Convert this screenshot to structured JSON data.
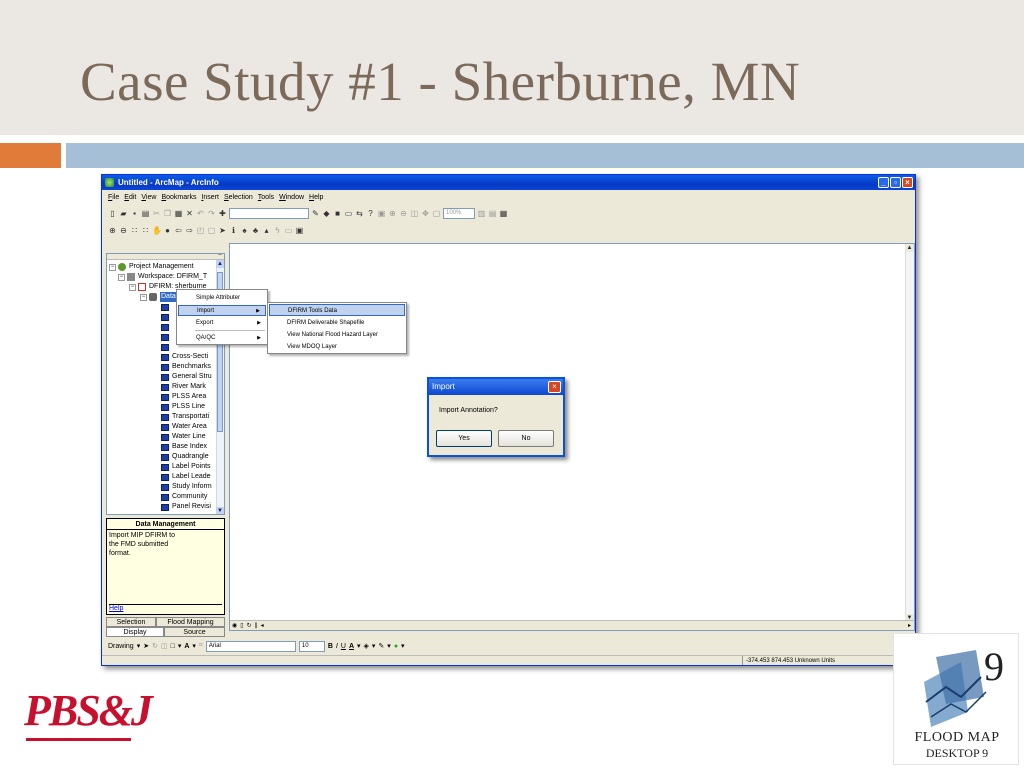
{
  "slide": {
    "title": "Case Study #1 - Sherburne, MN",
    "colors": {
      "title": "#7b6a5a",
      "header_bg": "#ebe8e4",
      "accent_orange": "#e07b39",
      "accent_blue": "#a4bfd6"
    }
  },
  "window": {
    "title": "Untitled - ArcMap - ArcInfo",
    "menu": [
      "File",
      "Edit",
      "View",
      "Bookmarks",
      "Insert",
      "Selection",
      "Tools",
      "Window",
      "Help"
    ],
    "zoom": "100%"
  },
  "toc": {
    "items": [
      {
        "label": "Project Management",
        "icon": "project-icon"
      },
      {
        "label": "Workspace: DFIRM_T",
        "icon": "workspace-icon"
      },
      {
        "label": "DFIRM: sherburne_",
        "icon": "dfirm-icon"
      },
      {
        "label": "Data",
        "icon": "database-icon"
      },
      {
        "label": "Cross-Secti",
        "icon": "layer-icon"
      },
      {
        "label": "Benchmarks",
        "icon": "layer-icon"
      },
      {
        "label": "General Stru",
        "icon": "layer-icon"
      },
      {
        "label": "River Mark",
        "icon": "layer-icon"
      },
      {
        "label": "PLSS Area",
        "icon": "layer-icon"
      },
      {
        "label": "PLSS Line",
        "icon": "layer-icon"
      },
      {
        "label": "Transportati",
        "icon": "layer-icon"
      },
      {
        "label": "Water Area",
        "icon": "layer-icon"
      },
      {
        "label": "Water Line",
        "icon": "layer-icon"
      },
      {
        "label": "Base Index",
        "icon": "layer-icon"
      },
      {
        "label": "Quadrangle",
        "icon": "layer-icon"
      },
      {
        "label": "Label Points",
        "icon": "layer-icon"
      },
      {
        "label": "Label Leade",
        "icon": "layer-icon"
      },
      {
        "label": "Study Inform",
        "icon": "layer-icon"
      },
      {
        "label": "Community",
        "icon": "layer-icon"
      },
      {
        "label": "Panel Revisi",
        "icon": "layer-icon"
      }
    ]
  },
  "help": {
    "title": "Data Management",
    "text": "Import MIP DFIRM to the FMD submitted format.",
    "link": "Help"
  },
  "tabs": {
    "selection": "Selection",
    "flood_mapping": "Flood Mapping",
    "display": "Display",
    "source": "Source"
  },
  "context_menu": {
    "items": [
      {
        "label": "Simple Attributer",
        "submenu": false
      },
      {
        "label": "Import",
        "submenu": true,
        "highlighted": true
      },
      {
        "label": "Export",
        "submenu": true
      },
      {
        "label": "QA/QC",
        "submenu": true
      }
    ]
  },
  "submenu": {
    "items": [
      {
        "label": "DFIRM Tools Data",
        "highlighted": true
      },
      {
        "label": "DFIRM Deliverable Shapefile"
      },
      {
        "label": "View National Flood Hazard Layer"
      },
      {
        "label": "View MDOQ Layer"
      }
    ]
  },
  "dialog": {
    "title": "Import",
    "message": "Import Annotation?",
    "yes": "Yes",
    "no": "No"
  },
  "drawing": {
    "label": "Drawing",
    "font": "Arial",
    "size": "10",
    "bold": "B",
    "italic": "I",
    "underline": "U",
    "text_tool": "A"
  },
  "status": {
    "coords": "-374.453  874.453 Unknown Units"
  },
  "logos": {
    "pbsj": "PBS&J",
    "product_name": "FLOOD MAP",
    "product_edition": "DESKTOP 9",
    "product_version_mark": "9"
  }
}
